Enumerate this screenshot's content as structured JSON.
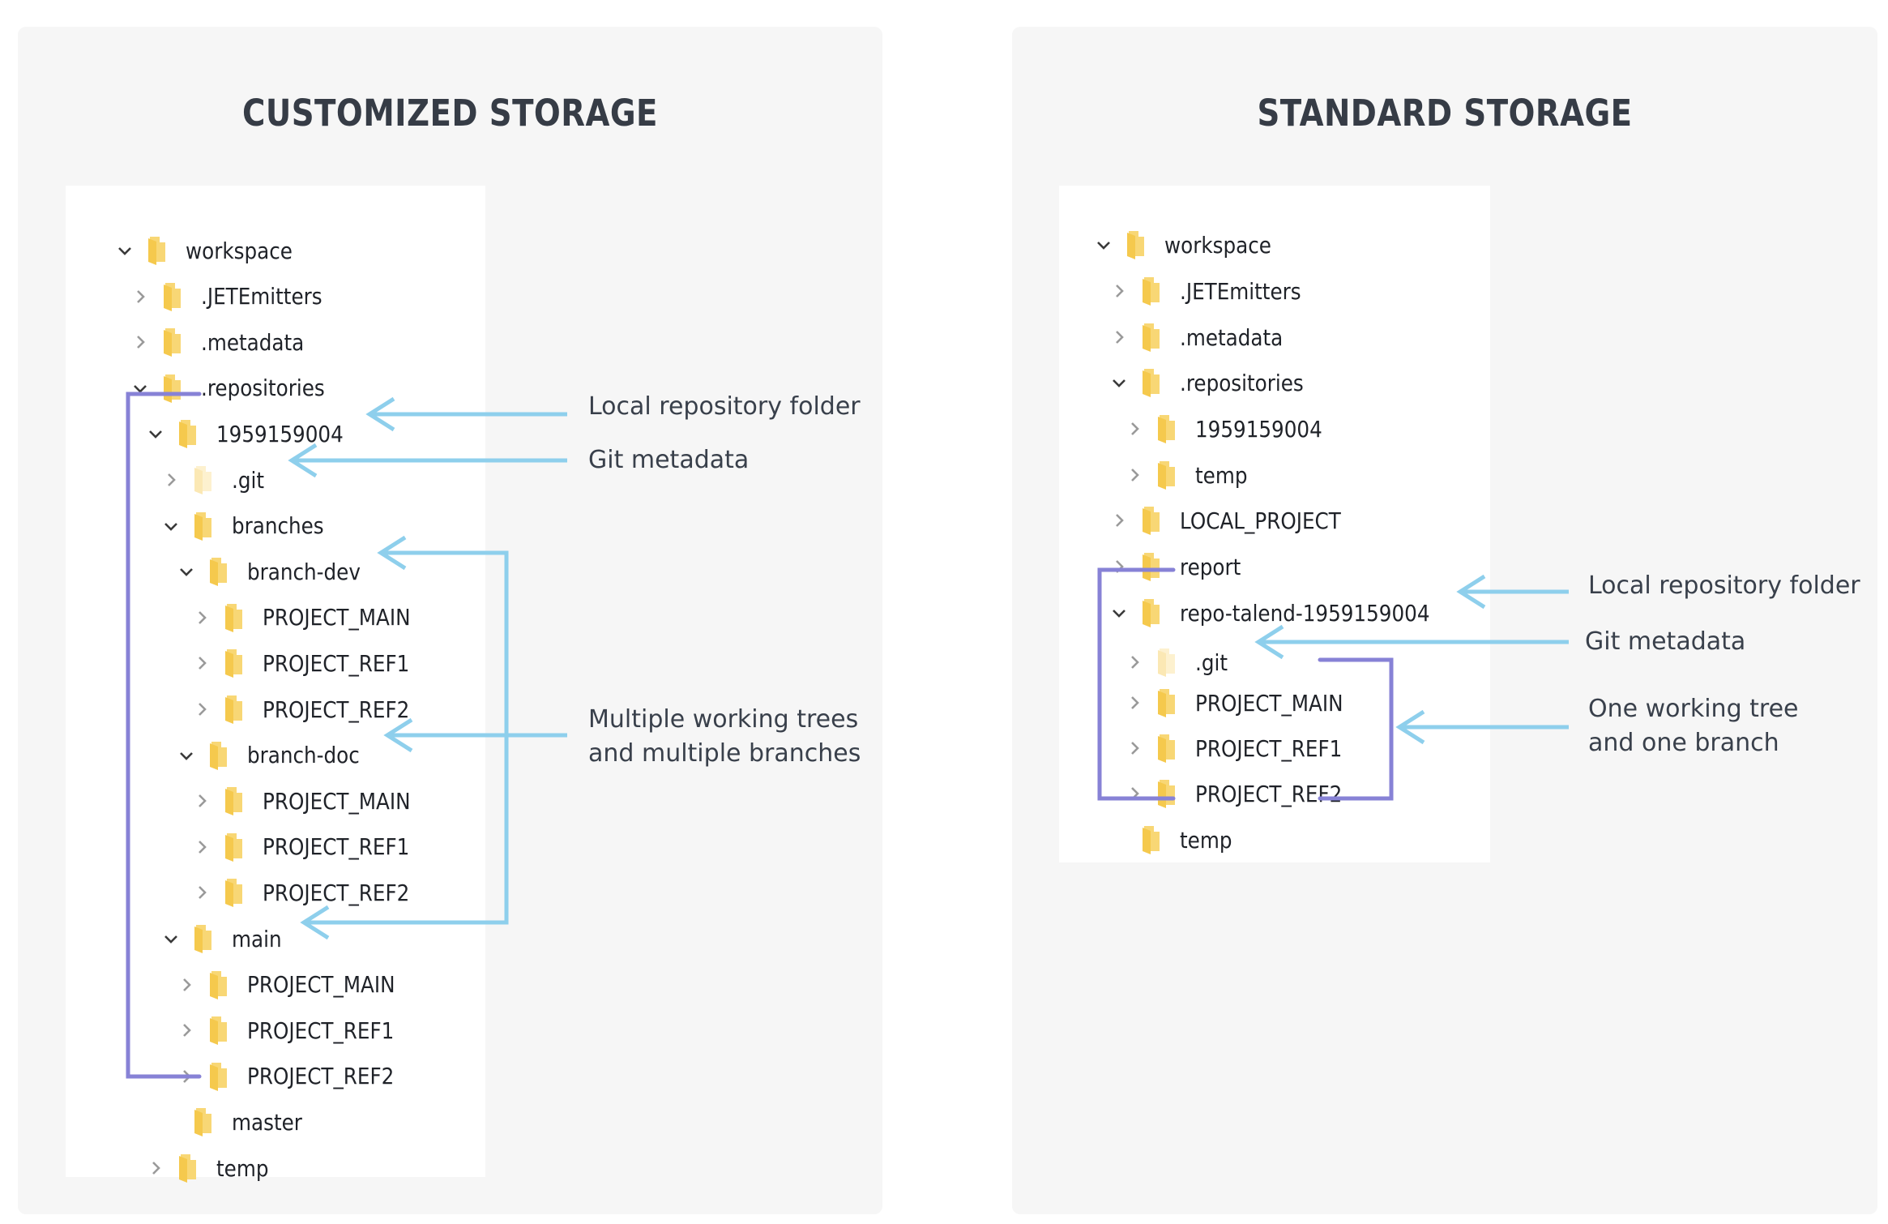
{
  "colors": {
    "panel_bg": "#f6f6f6",
    "tree_bg": "#ffffff",
    "title": "#363c46",
    "bracket": "#8782d6",
    "arrow": "#8ecfec",
    "folder": "#f5c94d",
    "folder_faded": "#fbe8b4"
  },
  "customized": {
    "title": "CUSTOMIZED STORAGE",
    "tree": [
      {
        "label": "workspace",
        "depth": 0,
        "toggle": "expanded",
        "faded": false
      },
      {
        "label": ".JETEmitters",
        "depth": 1,
        "toggle": "collapsed",
        "faded": false
      },
      {
        "label": ".metadata",
        "depth": 1,
        "toggle": "collapsed",
        "faded": false
      },
      {
        "label": ".repositories",
        "depth": 1,
        "toggle": "expanded",
        "faded": false
      },
      {
        "label": "1959159004",
        "depth": 2,
        "toggle": "expanded",
        "faded": false
      },
      {
        "label": ".git",
        "depth": 3,
        "toggle": "collapsed",
        "faded": true
      },
      {
        "label": "branches",
        "depth": 3,
        "toggle": "expanded",
        "faded": false
      },
      {
        "label": "branch-dev",
        "depth": 4,
        "toggle": "expanded",
        "faded": false
      },
      {
        "label": "PROJECT_MAIN",
        "depth": 5,
        "toggle": "collapsed",
        "faded": false
      },
      {
        "label": "PROJECT_REF1",
        "depth": 5,
        "toggle": "collapsed",
        "faded": false
      },
      {
        "label": "PROJECT_REF2",
        "depth": 5,
        "toggle": "collapsed",
        "faded": false
      },
      {
        "label": "branch-doc",
        "depth": 4,
        "toggle": "expanded",
        "faded": false
      },
      {
        "label": "PROJECT_MAIN",
        "depth": 5,
        "toggle": "collapsed",
        "faded": false
      },
      {
        "label": "PROJECT_REF1",
        "depth": 5,
        "toggle": "collapsed",
        "faded": false
      },
      {
        "label": "PROJECT_REF2",
        "depth": 5,
        "toggle": "collapsed",
        "faded": false
      },
      {
        "label": "main",
        "depth": 3,
        "toggle": "expanded",
        "faded": false
      },
      {
        "label": "PROJECT_MAIN",
        "depth": 4,
        "toggle": "collapsed",
        "faded": false
      },
      {
        "label": "PROJECT_REF1",
        "depth": 4,
        "toggle": "collapsed",
        "faded": false
      },
      {
        "label": "PROJECT_REF2",
        "depth": 4,
        "toggle": "collapsed",
        "faded": false
      },
      {
        "label": "master",
        "depth": 3,
        "toggle": "none",
        "faded": false
      },
      {
        "label": "temp",
        "depth": 2,
        "toggle": "collapsed",
        "faded": false
      }
    ],
    "annotations": {
      "local_repo": "Local repository folder",
      "git_metadata": "Git metadata",
      "multi_line1": "Multiple working trees",
      "multi_line2": "and multiple branches"
    }
  },
  "standard": {
    "title": "STANDARD STORAGE",
    "tree": [
      {
        "label": "workspace",
        "depth": 0,
        "toggle": "expanded",
        "faded": false
      },
      {
        "label": ".JETEmitters",
        "depth": 1,
        "toggle": "collapsed",
        "faded": false
      },
      {
        "label": ".metadata",
        "depth": 1,
        "toggle": "collapsed",
        "faded": false
      },
      {
        "label": ".repositories",
        "depth": 1,
        "toggle": "expanded",
        "faded": false
      },
      {
        "label": "1959159004",
        "depth": 2,
        "toggle": "collapsed",
        "faded": false
      },
      {
        "label": "temp",
        "depth": 2,
        "toggle": "collapsed",
        "faded": false
      },
      {
        "label": "LOCAL_PROJECT",
        "depth": 1,
        "toggle": "collapsed",
        "faded": false
      },
      {
        "label": "report",
        "depth": 1,
        "toggle": "collapsed",
        "faded": false
      },
      {
        "label": "repo-talend-1959159004",
        "depth": 1,
        "toggle": "expanded",
        "faded": false
      },
      {
        "label": ".git",
        "depth": 2,
        "toggle": "collapsed",
        "faded": true
      },
      {
        "label": "PROJECT_MAIN",
        "depth": 2,
        "toggle": "collapsed",
        "faded": false
      },
      {
        "label": "PROJECT_REF1",
        "depth": 2,
        "toggle": "collapsed",
        "faded": false
      },
      {
        "label": "PROJECT_REF2",
        "depth": 2,
        "toggle": "collapsed",
        "faded": false
      },
      {
        "label": "temp",
        "depth": 1,
        "toggle": "none",
        "faded": false
      }
    ],
    "annotations": {
      "local_repo": "Local repository folder",
      "git_metadata": "Git metadata",
      "one_line1": "One working tree",
      "one_line2": "and one branch"
    }
  }
}
